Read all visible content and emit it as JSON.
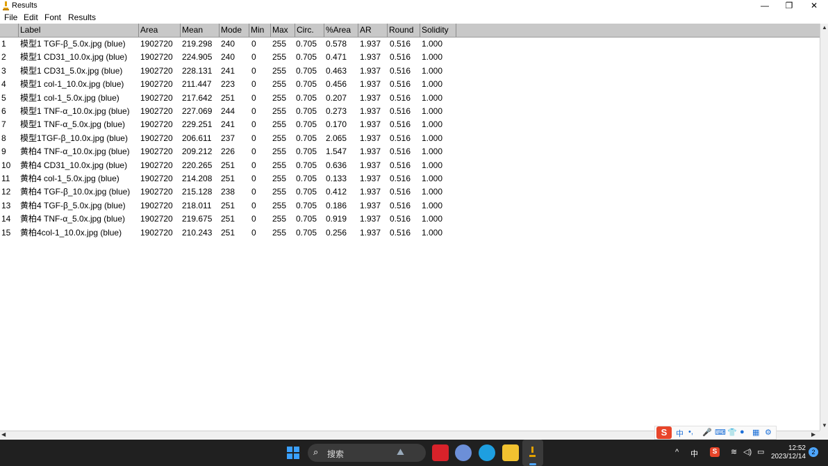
{
  "window": {
    "title": "Results",
    "minimize": "—",
    "restore": "❐",
    "close": "✕"
  },
  "menu": [
    "File",
    "Edit",
    "Font",
    "Results"
  ],
  "table": {
    "columns": [
      "Label",
      "Area",
      "Mean",
      "Mode",
      "Min",
      "Max",
      "Circ.",
      "%Area",
      "AR",
      "Round",
      "Solidity"
    ],
    "rows": [
      [
        "1",
        "模型1  TGF-β_5.0x.jpg (blue)",
        "1902720",
        "219.298",
        "240",
        "0",
        "255",
        "0.705",
        "0.578",
        "1.937",
        "0.516",
        "1.000"
      ],
      [
        "2",
        "模型1 CD31_10.0x.jpg (blue)",
        "1902720",
        "224.905",
        "240",
        "0",
        "255",
        "0.705",
        "0.471",
        "1.937",
        "0.516",
        "1.000"
      ],
      [
        "3",
        "模型1 CD31_5.0x.jpg (blue)",
        "1902720",
        "228.131",
        "241",
        "0",
        "255",
        "0.705",
        "0.463",
        "1.937",
        "0.516",
        "1.000"
      ],
      [
        "4",
        "模型1 col-1_10.0x.jpg (blue)",
        "1902720",
        "211.447",
        "223",
        "0",
        "255",
        "0.705",
        "0.456",
        "1.937",
        "0.516",
        "1.000"
      ],
      [
        "5",
        "模型1 col-1_5.0x.jpg (blue)",
        "1902720",
        "217.642",
        "251",
        "0",
        "255",
        "0.705",
        "0.207",
        "1.937",
        "0.516",
        "1.000"
      ],
      [
        "6",
        "模型1 TNF-α_10.0x.jpg (blue)",
        "1902720",
        "227.069",
        "244",
        "0",
        "255",
        "0.705",
        "0.273",
        "1.937",
        "0.516",
        "1.000"
      ],
      [
        "7",
        "模型1 TNF-α_5.0x.jpg (blue)",
        "1902720",
        "229.251",
        "241",
        "0",
        "255",
        "0.705",
        "0.170",
        "1.937",
        "0.516",
        "1.000"
      ],
      [
        "8",
        "模型1TGF-β_10.0x.jpg (blue)",
        "1902720",
        "206.611",
        "237",
        "0",
        "255",
        "0.705",
        "2.065",
        "1.937",
        "0.516",
        "1.000"
      ],
      [
        "9",
        "黄柏4  TNF-α_10.0x.jpg (blue)",
        "1902720",
        "209.212",
        "226",
        "0",
        "255",
        "0.705",
        "1.547",
        "1.937",
        "0.516",
        "1.000"
      ],
      [
        "10",
        "黄柏4 CD31_10.0x.jpg (blue)",
        "1902720",
        "220.265",
        "251",
        "0",
        "255",
        "0.705",
        "0.636",
        "1.937",
        "0.516",
        "1.000"
      ],
      [
        "11",
        "黄柏4 col-1_5.0x.jpg (blue)",
        "1902720",
        "214.208",
        "251",
        "0",
        "255",
        "0.705",
        "0.133",
        "1.937",
        "0.516",
        "1.000"
      ],
      [
        "12",
        "黄柏4 TGF-β_10.0x.jpg (blue)",
        "1902720",
        "215.128",
        "238",
        "0",
        "255",
        "0.705",
        "0.412",
        "1.937",
        "0.516",
        "1.000"
      ],
      [
        "13",
        "黄柏4 TGF-β_5.0x.jpg (blue)",
        "1902720",
        "218.011",
        "251",
        "0",
        "255",
        "0.705",
        "0.186",
        "1.937",
        "0.516",
        "1.000"
      ],
      [
        "14",
        "黄柏4 TNF-α_5.0x.jpg (blue)",
        "1902720",
        "219.675",
        "251",
        "0",
        "255",
        "0.705",
        "0.919",
        "1.937",
        "0.516",
        "1.000"
      ],
      [
        "15",
        "黄柏4col-1_10.0x.jpg (blue)",
        "1902720",
        "210.243",
        "251",
        "0",
        "255",
        "0.705",
        "0.256",
        "1.937",
        "0.516",
        "1.000"
      ]
    ]
  },
  "taskbar": {
    "search_placeholder": "搜索",
    "ime_label": "中",
    "time": "12:52",
    "date": "2023/12/14",
    "notification_count": "2"
  },
  "colors": {
    "header_bg": "#c8c8c8",
    "taskbar_bg": "#202020",
    "accent": "#3aa0ff",
    "ime_brand": "#e8452a"
  },
  "icons": {
    "app": "microscope-icon",
    "minimize": "minimize-icon",
    "restore": "restore-icon",
    "close": "close-icon",
    "start": "windows-start-icon",
    "search": "search-icon",
    "wifi": "wifi-icon",
    "volume": "volume-icon",
    "battery": "battery-icon"
  }
}
